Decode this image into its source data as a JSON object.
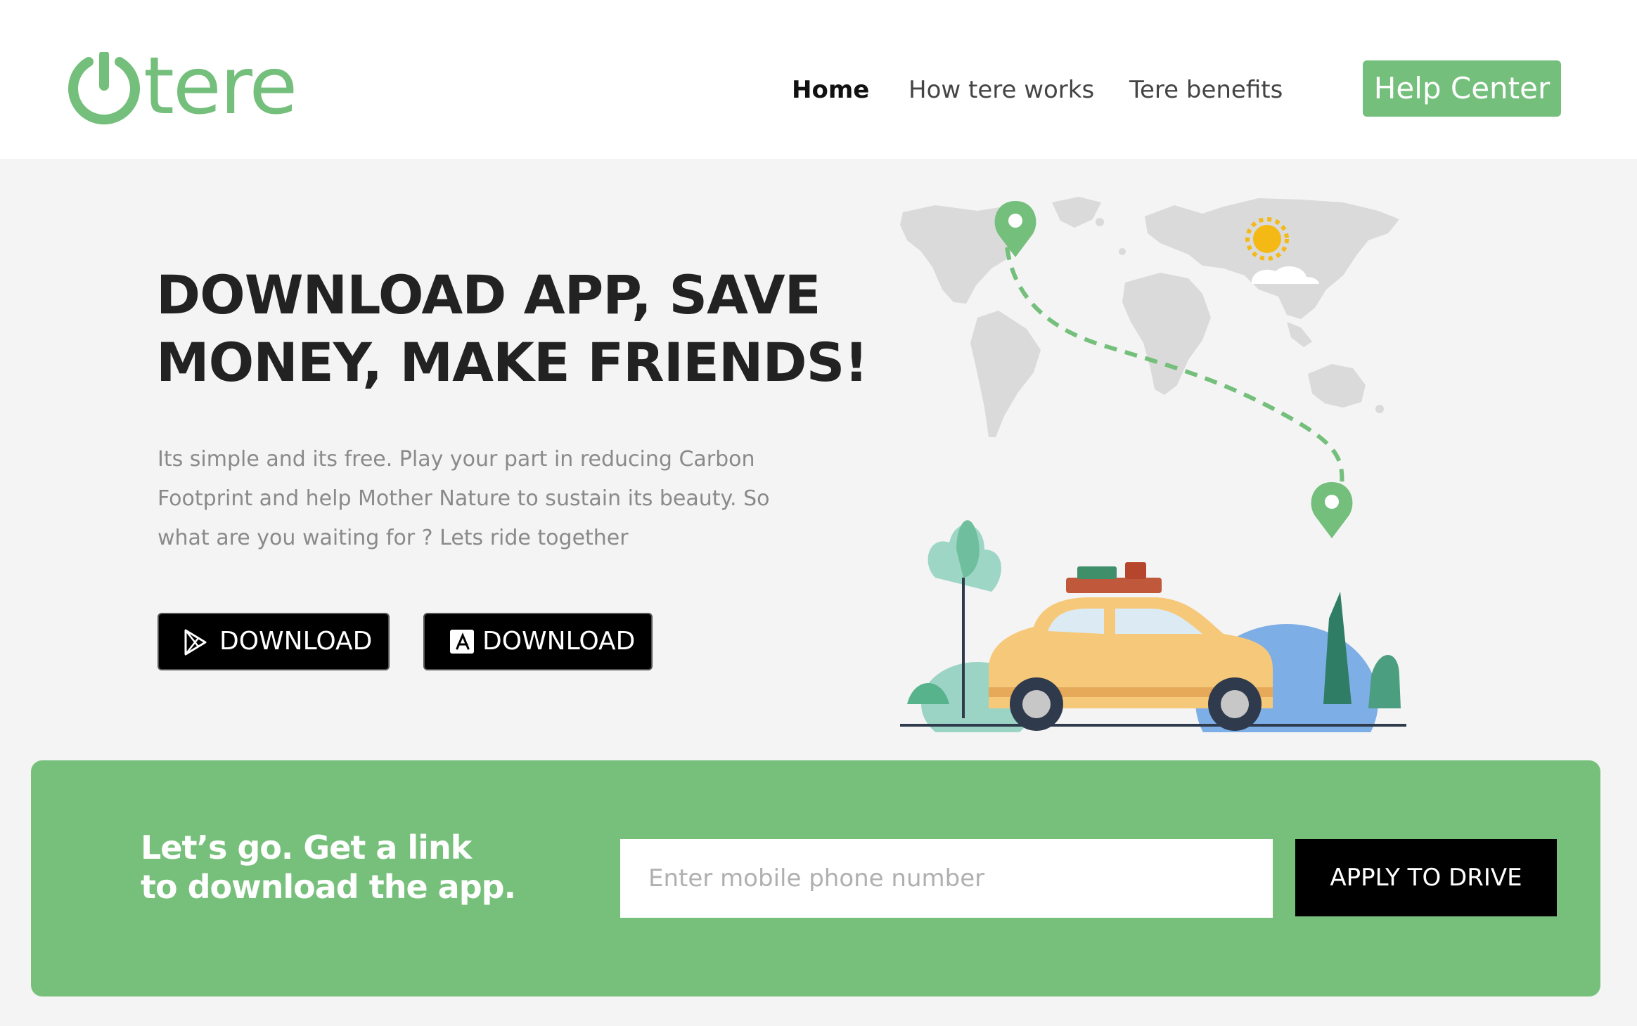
{
  "brand": {
    "name": "tere",
    "accent_color": "#74bf7b",
    "logo_icon": "power-icon"
  },
  "nav": {
    "items": [
      {
        "label": "Home",
        "active": true
      },
      {
        "label": "How tere works",
        "active": false
      },
      {
        "label": "Tere benefits",
        "active": false
      }
    ],
    "help_label": "Help Center"
  },
  "hero": {
    "headline_line1": "DOWNLOAD APP, SAVE",
    "headline_line2": "MONEY, MAKE FRIENDS!",
    "description": "Its simple and its free. Play your part in reducing Carbon Footprint and help Mother Nature to sustain its beauty. So what are you waiting for ? Lets ride together",
    "buttons": [
      {
        "label": "DOWNLOAD",
        "icon": "google-play-icon"
      },
      {
        "label": "DOWNLOAD",
        "icon": "app-store-icon"
      }
    ],
    "illustration": "world-map-road-trip-car-illustration"
  },
  "cta": {
    "text_line1": "Let’s go. Get a link",
    "text_line2": "to download the app.",
    "phone_placeholder": "Enter mobile phone number",
    "apply_label": "APPLY TO DRIVE"
  }
}
